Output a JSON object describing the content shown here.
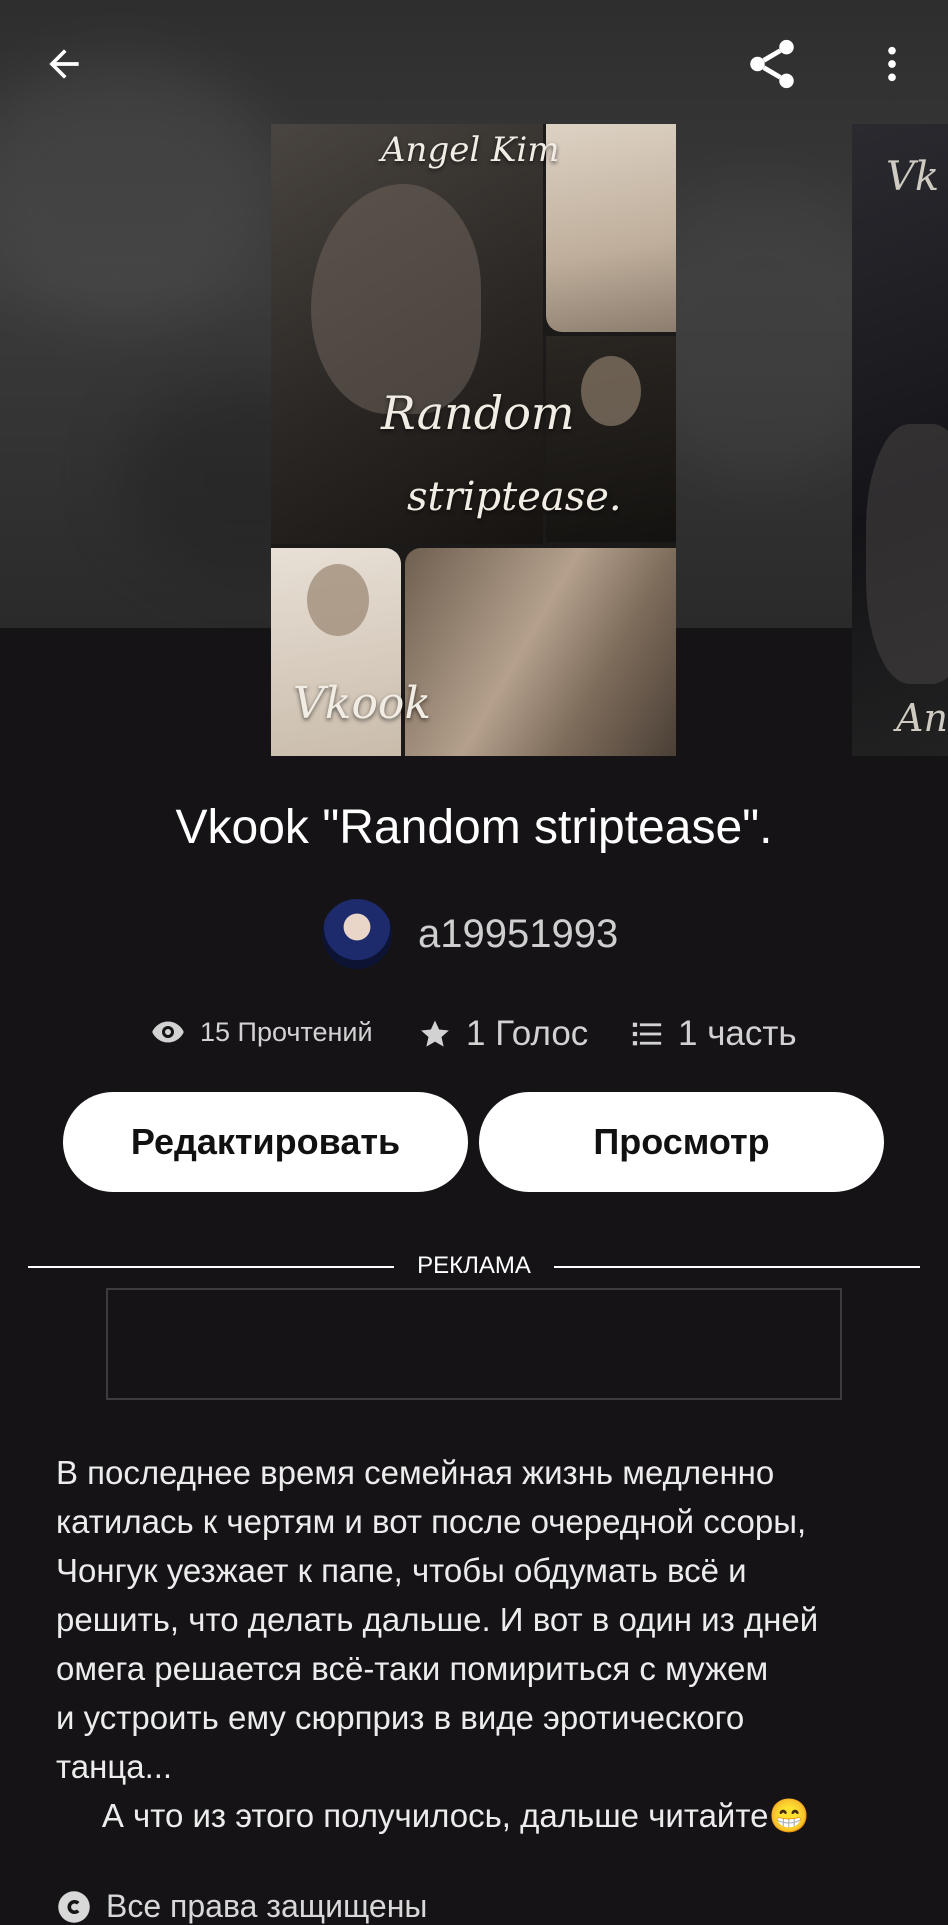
{
  "header": {
    "back_icon": "arrow-left-icon",
    "share_icon": "share-icon",
    "more_icon": "more-vertical-icon"
  },
  "cover": {
    "author_text": "Angel Kim",
    "title_line1": "Random",
    "title_line2": "striptease.",
    "ship_text": "Vkook"
  },
  "next_cover": {
    "top_text": "Vk",
    "bottom_text": "An"
  },
  "story": {
    "title": "Vkook \"Random striptease\".",
    "author": "a19951993",
    "stats": {
      "reads": "15 Прочтений",
      "votes": "1 Голос",
      "parts": "1 часть"
    },
    "buttons": {
      "edit": "Редактировать",
      "preview": "Просмотр"
    },
    "ad_label": "РЕКЛАМА",
    "description": "В последнее время семейная жизнь медленно\nкатилась к чертям и вот после очередной ссоры,\nЧонгук уезжает к папе, чтобы обдумать всё и\nрешить, что делать дальше. И вот в один из дней\nомега решается всё-таки помириться с мужем\nи устроить ему сюрприз в виде эротического\nтанца...\n     А что из этого получилось, дальше читайте😁",
    "copyright": "Все права защищены"
  },
  "colors": {
    "background": "#151316",
    "button_bg": "#ffffff",
    "text": "#ffffff"
  }
}
